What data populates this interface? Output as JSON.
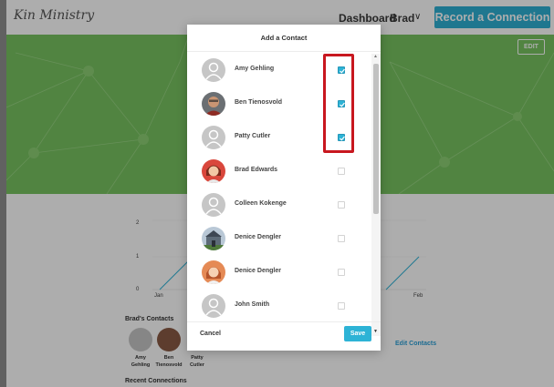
{
  "app": {
    "logo": "Kin Ministry",
    "nav": {
      "dashboard": "Dashboard",
      "user": "Brad",
      "user_chevron": "∨",
      "record_button": "Record a Connection"
    },
    "edit_label": "EDIT"
  },
  "background": {
    "chart_tick_1": "1",
    "chart_tick_0": "0",
    "chart_x_start": "Jan",
    "chart_x_end": "Feb",
    "contacts_title": "Brad's Contacts",
    "contacts": [
      {
        "name_line1": "Amy",
        "name_line2": "Gehling"
      },
      {
        "name_line1": "Ben",
        "name_line2": "Tienosvold"
      },
      {
        "name_line1": "Patty",
        "name_line2": "Cutler"
      }
    ],
    "edit_contacts": "Edit Contacts",
    "recent_title": "Recent Connections"
  },
  "modal": {
    "title": "Add a Contact",
    "cancel": "Cancel",
    "save": "Save",
    "contacts": [
      {
        "name": "Amy Gehling",
        "checked": true,
        "avatar": "placeholder-avatar"
      },
      {
        "name": "Ben Tienosvold",
        "checked": true,
        "avatar": "photo-avatar"
      },
      {
        "name": "Patty Cutler",
        "checked": true,
        "avatar": "placeholder-avatar"
      },
      {
        "name": "Brad Edwards",
        "checked": false,
        "avatar": "photo-avatar"
      },
      {
        "name": "Colleen Kokenge",
        "checked": false,
        "avatar": "placeholder-avatar"
      },
      {
        "name": "Denice Dengler",
        "checked": false,
        "avatar": "photo-avatar"
      },
      {
        "name": "Denice Dengler",
        "checked": false,
        "avatar": "photo-avatar"
      },
      {
        "name": "John Smith",
        "checked": false,
        "avatar": "placeholder-avatar"
      }
    ]
  },
  "colors": {
    "accent": "#2db3d6",
    "hero_green": "#78c361",
    "highlight_red": "#c8171f"
  }
}
